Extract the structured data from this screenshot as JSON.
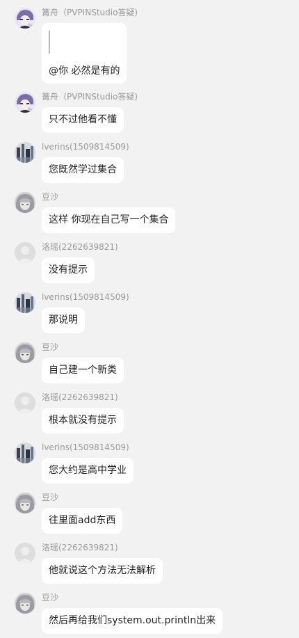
{
  "messages": [
    {
      "sender": "篝舟（PVPINStudio答疑)",
      "avatar": "anime-avatar-icon",
      "text": "@你 必然是有的",
      "has_quote": true
    },
    {
      "sender": "篝舟（PVPINStudio答疑)",
      "avatar": "anime-avatar-icon",
      "text": "只不过他看不懂"
    },
    {
      "sender": "lverins(1509814509)",
      "avatar": "building-avatar-icon",
      "text": "您既然学过集合"
    },
    {
      "sender": "豆沙",
      "avatar": "grey-hair-avatar-icon",
      "text": "这样 你现在自己写一个集合"
    },
    {
      "sender": "洛瑶(2262639821)",
      "avatar": "default-avatar-icon",
      "text": "没有提示"
    },
    {
      "sender": "lverins(1509814509)",
      "avatar": "building-avatar-icon",
      "text": "那说明"
    },
    {
      "sender": "豆沙",
      "avatar": "grey-hair-avatar-icon",
      "text": "自己建一个新类"
    },
    {
      "sender": "洛瑶(2262639821)",
      "avatar": "default-avatar-icon",
      "text": "根本就没有提示"
    },
    {
      "sender": "lverins(1509814509)",
      "avatar": "building-avatar-icon",
      "text": "您大约是高中学业"
    },
    {
      "sender": "豆沙",
      "avatar": "grey-hair-avatar-icon",
      "text": "往里面add东西"
    },
    {
      "sender": "洛瑶(2262639821)",
      "avatar": "default-avatar-icon",
      "text": "他就说这个方法无法解析"
    },
    {
      "sender": "豆沙",
      "avatar": "grey-hair-avatar-icon",
      "text": "然后再给我们system.out.println出来"
    }
  ]
}
